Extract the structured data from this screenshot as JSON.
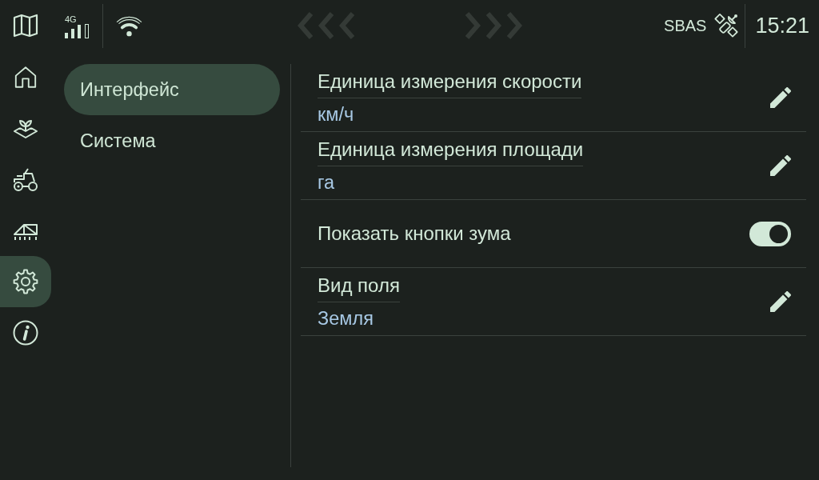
{
  "status_bar": {
    "network": "4G",
    "correction": "SBAS",
    "time": "15:21"
  },
  "nav_arrows": [
    {
      "kind": "back",
      "disabled": true
    },
    {
      "kind": "forward",
      "disabled": true
    }
  ],
  "rail": [
    {
      "kind": "home",
      "selected": false
    },
    {
      "kind": "crops",
      "selected": false
    },
    {
      "kind": "tractor",
      "selected": false
    },
    {
      "kind": "implement",
      "selected": false
    },
    {
      "kind": "settings",
      "selected": true
    },
    {
      "kind": "info",
      "selected": false
    }
  ],
  "menu": [
    {
      "label": "Интерфейс",
      "selected": true
    },
    {
      "label": "Система",
      "selected": false
    }
  ],
  "settings": [
    {
      "kind": "choice",
      "title": "Единица измерения скорости",
      "value": "км/ч"
    },
    {
      "kind": "choice",
      "title": "Единица измерения площади",
      "value": "га"
    },
    {
      "kind": "toggle",
      "title": "Показать кнопки зума",
      "on": true
    },
    {
      "kind": "choice",
      "title": "Вид поля",
      "value": "Земля"
    }
  ]
}
